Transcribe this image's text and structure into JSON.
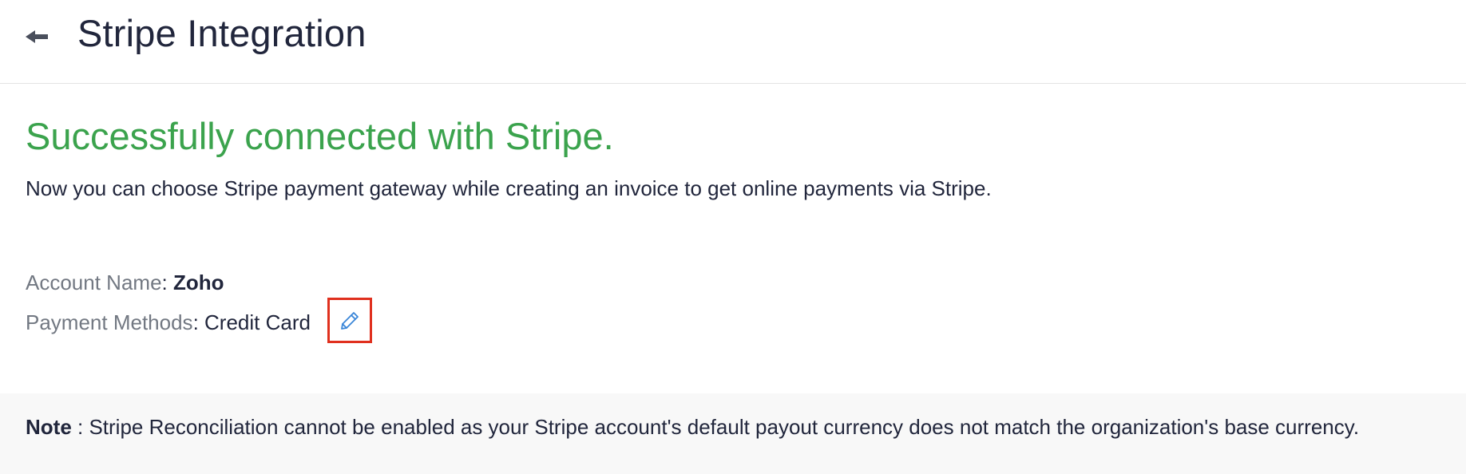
{
  "header": {
    "title": "Stripe Integration",
    "back_icon": "back-arrow-icon"
  },
  "status": {
    "heading": "Successfully connected with Stripe.",
    "heading_color": "#3ba34d",
    "description": "Now you can choose Stripe payment gateway while creating an invoice to get online payments via Stripe."
  },
  "details": {
    "account_label": "Account Name",
    "account_value": "Zoho",
    "payment_label": "Payment Methods",
    "payment_value": "Credit Card",
    "separator": ": ",
    "edit_icon": "pencil-icon",
    "highlight_color": "#e0301e"
  },
  "note": {
    "label": "Note",
    "text": " : Stripe Reconciliation cannot be enabled as your Stripe account's default payout currency does not match the organization's base currency."
  }
}
